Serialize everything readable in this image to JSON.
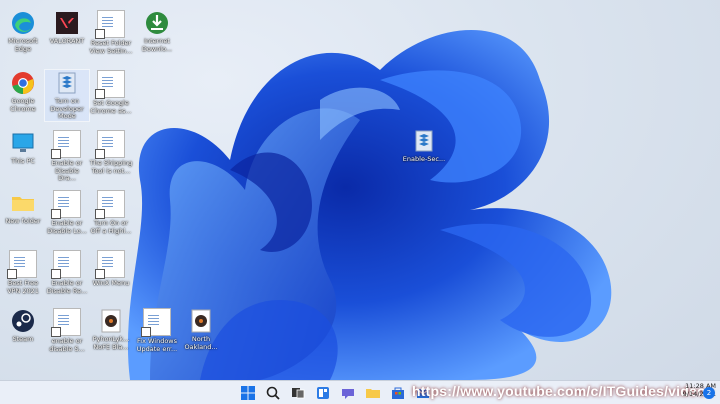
{
  "desktop_icons": [
    {
      "label": "Microsoft Edge"
    },
    {
      "label": "VALORANT"
    },
    {
      "label": "Reset Folder View Settin..."
    },
    {
      "label": "Internet Downlo..."
    },
    {
      "label": "Google Chrome"
    },
    {
      "label": "Turn on Developer Mode"
    },
    {
      "label": "Set Google Chrome as..."
    },
    {
      "label": "This PC"
    },
    {
      "label": "Enable or Disable Dra..."
    },
    {
      "label": "The Shipping Tool is not..."
    },
    {
      "label": "New folder"
    },
    {
      "label": "Enable or Disable Lo..."
    },
    {
      "label": "Turn On or Off a Highl..."
    },
    {
      "label": "Best Free VPN 2021"
    },
    {
      "label": "Enable or Disable Re..."
    },
    {
      "label": "WinX Menu"
    },
    {
      "label": "Steam"
    },
    {
      "label": "enable or disable S..."
    },
    {
      "label": "PyhonLyk... NoFE Bla..."
    },
    {
      "label": "Fix Windows Update err..."
    },
    {
      "label": "North Oakland..."
    }
  ],
  "floating_icon": {
    "label": "Enable-Sec..."
  },
  "taskbar": {
    "url_overlay": "https://www.youtube.com/c/ITGuides/videos",
    "clock_time": "11:28 AM",
    "clock_date": "9/14/2021",
    "notification_count": "2"
  },
  "colors": {
    "bloom_dark": "#0a2fb8",
    "bloom_mid": "#1e5ae6",
    "bloom_light": "#5a9bff"
  }
}
